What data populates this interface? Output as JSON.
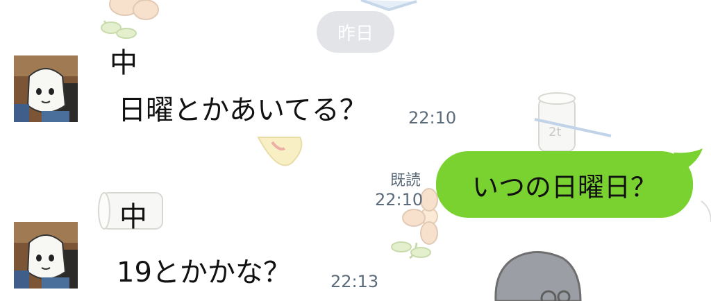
{
  "date_separator": "昨日",
  "messages": [
    {
      "sender": "中",
      "text": "日曜とかあいてる？",
      "time": "22:10"
    },
    {
      "text": "いつの日曜日？",
      "read_label": "既読",
      "time": "22:10"
    },
    {
      "sender": "中",
      "text": "19とかかな？",
      "time": "22:13"
    }
  ],
  "colors": {
    "outgoing_bubble": "#7ad231",
    "date_pill": "#e3e4e8",
    "timestamp": "#5b6b7a"
  }
}
